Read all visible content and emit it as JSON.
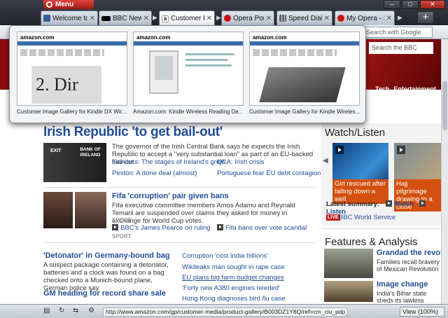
{
  "menu": {
    "label": "Menu"
  },
  "tabs": [
    {
      "label": "Welcome to F...",
      "icon": "facebook-icon",
      "color": "#3b5998"
    },
    {
      "label": "BBC News ...",
      "icon": "bbc-icon",
      "color": "#000000"
    },
    {
      "label": "Customer I...",
      "icon": "amazon-icon",
      "color": "#ffffff"
    },
    {
      "label": "Opera Portal",
      "icon": "opera-icon",
      "color": "#cc1010"
    },
    {
      "label": "Speed Dial",
      "icon": "speed-dial-icon",
      "color": "#666666"
    },
    {
      "label": "My Opera - S...",
      "icon": "opera-icon",
      "color": "#cc1010"
    }
  ],
  "search": {
    "placeholder": "Search with Google"
  },
  "bbc_search": {
    "placeholder": "Search the BBC"
  },
  "bbc_nav": [
    "Tech",
    "Entertainment"
  ],
  "preview": [
    {
      "caption": "Customer Image Gallery for Kindle DX Wir...",
      "brand": "amazon.com",
      "image_text": "2. Dir"
    },
    {
      "caption": "Amazon.com: Kindle Wireless Reading De...",
      "brand": "amazon.com"
    },
    {
      "caption": "Customer Image Gallery for Kindle Wireles...",
      "brand": "amazon.com"
    }
  ],
  "main": {
    "headline": "Irish Republic 'to get bail-out'",
    "lead_body": "The governor of the Irish Central Bank says he expects the Irish Republic to accept a \"very substantial loan\" as part of an EU-backed bail-out.",
    "lead_links": [
      "Flanders: The stages of Ireland's grief",
      "Q&A: Irish crisis",
      "Peston: A done deal (almost)",
      "Portuguese fear EU debt contagion"
    ],
    "lead_img_text": "BANK OF IRELAND",
    "lead_img_exit": "EXIT",
    "story2_title": "Fifa 'corruption' pair given bans",
    "story2_body": "Fifa executive committee members Amos Adamu and Reynald Temarii are suspended over claims they asked for money in exchange for World Cup votes.",
    "story2_label": "SPORT",
    "story2_links": [
      "BBC's James Pearce on ruling",
      "Fifa bans over vote scandal"
    ],
    "story2_label2": "SPORT",
    "story3_title": "'Detonator' in Germany-bound bag",
    "story3_body": "A suspect package containing a detonator, batteries and a clock was found on a bag checked onto a Munich-bound plane, German police say.",
    "story4_title": "GM heading for record share sale",
    "side_links": [
      "Corruption 'cost India billions'",
      "Wikileaks man sought in rape case",
      "EU plans big farm budget changes",
      "'Forty new A380 engines needed'",
      "Hong Kong diagnoses bird flu case"
    ]
  },
  "watch": {
    "title": "Watch/Listen",
    "video1_caption": "Girl rescued after falling down a well",
    "video2_caption": "Hajj pilgrimage drawing to a close",
    "latest_label": "Latest summary:",
    "watch_label": "Watch",
    "listen_label": "Listen",
    "live_badge": "LIVE",
    "live_text": "BBC World Service"
  },
  "features": {
    "title": "Features & Analysis",
    "item1_title": "Grandad the revolu",
    "item1_body": "Families recall bravery of Mexican Revolution",
    "item2_title": "Image change",
    "item2_body": "India's Bihar state sheds its lawless image"
  },
  "status": {
    "url": "http://www.amazon.com/gp/customer-media/product-gallery/B003DZ1Y8Q/ref=cm_ciu_pdp_images_all",
    "zoom": "View (100%)"
  }
}
